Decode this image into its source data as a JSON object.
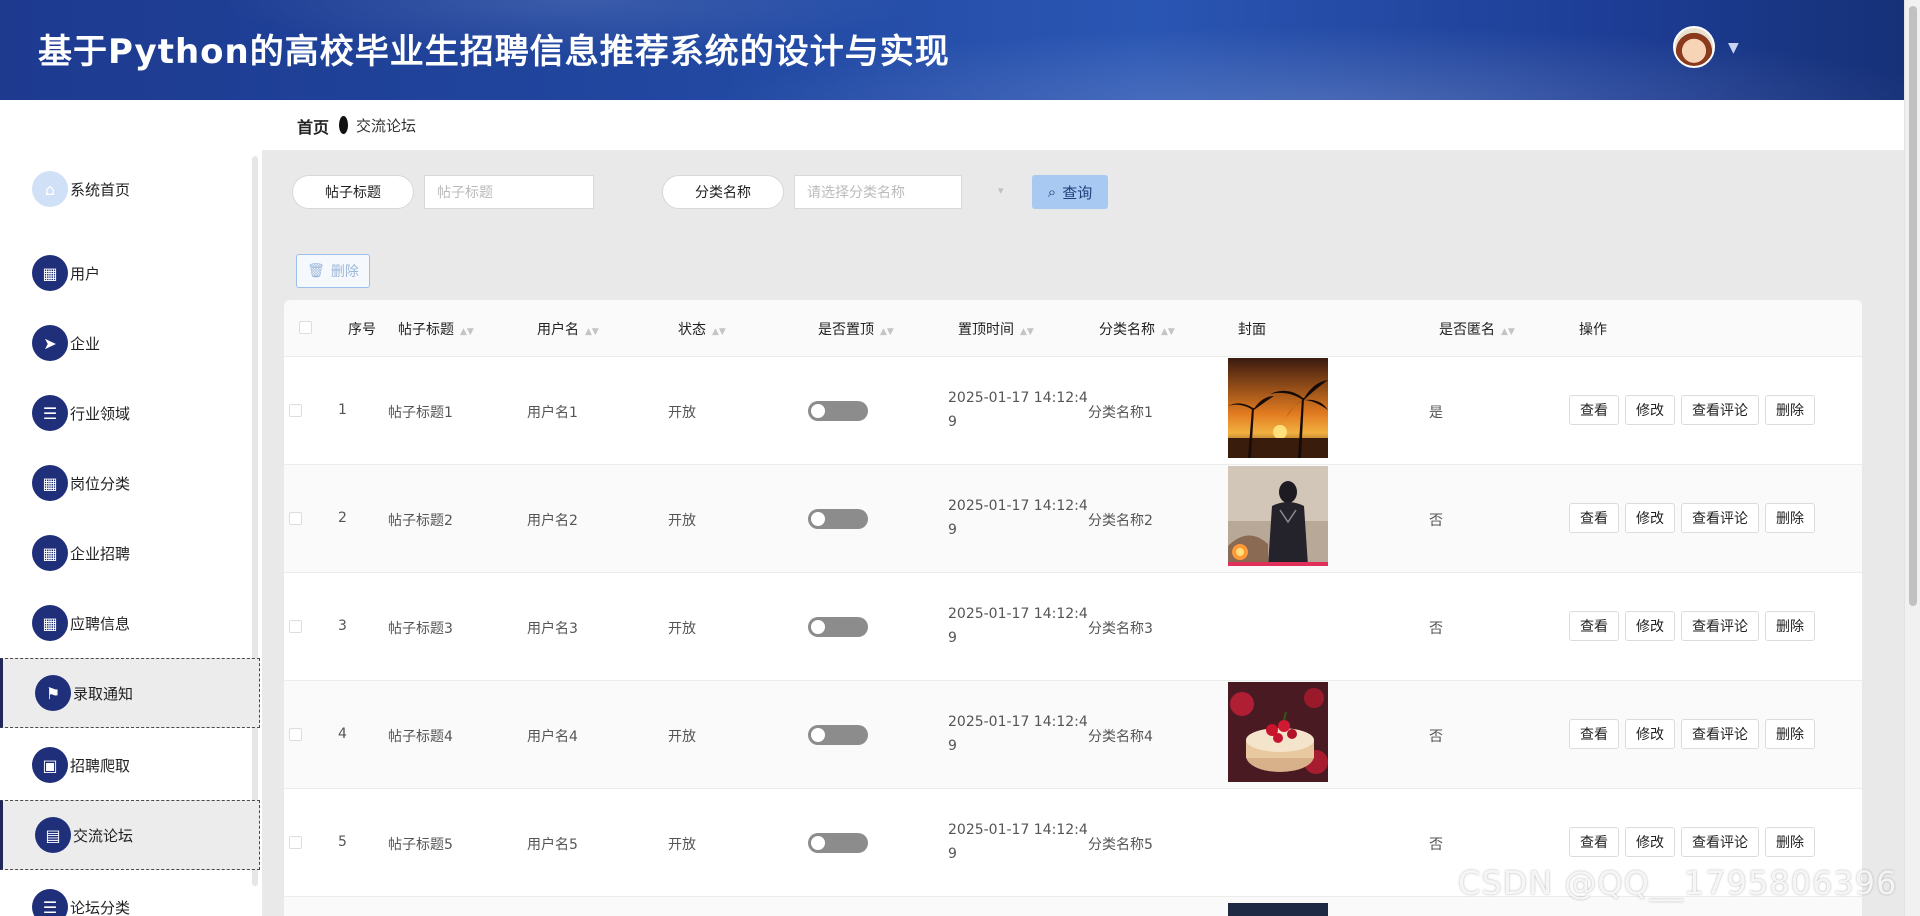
{
  "header": {
    "title": "基于Python的高校毕业生招聘信息推荐系统的设计与实现"
  },
  "breadcrumb": {
    "home": "首页",
    "current": "交流论坛"
  },
  "sidebar": {
    "items": [
      {
        "label": "系统首页",
        "icon": "home-icon"
      },
      {
        "label": "用户",
        "icon": "grid-icon"
      },
      {
        "label": "企业",
        "icon": "send-icon"
      },
      {
        "label": "行业领域",
        "icon": "list-icon"
      },
      {
        "label": "岗位分类",
        "icon": "grid-icon"
      },
      {
        "label": "企业招聘",
        "icon": "grid-icon"
      },
      {
        "label": "应聘信息",
        "icon": "grid-icon"
      },
      {
        "label": "录取通知",
        "icon": "flag-icon"
      },
      {
        "label": "招聘爬取",
        "icon": "briefcase-icon"
      },
      {
        "label": "交流论坛",
        "icon": "clipboard-icon"
      },
      {
        "label": "论坛分类",
        "icon": "list-icon"
      }
    ]
  },
  "search": {
    "title_label": "帖子标题",
    "title_placeholder": "帖子标题",
    "category_label": "分类名称",
    "category_placeholder": "请选择分类名称",
    "query_label": "查询",
    "delete_label": "删除"
  },
  "table": {
    "columns": [
      "序号",
      "帖子标题",
      "用户名",
      "状态",
      "是否置顶",
      "置顶时间",
      "分类名称",
      "封面",
      "是否匿名",
      "操作"
    ],
    "actions": [
      "查看",
      "修改",
      "查看评论",
      "删除"
    ],
    "rows": [
      {
        "index": "1",
        "title": "帖子标题1",
        "user": "用户名1",
        "status": "开放",
        "time_a": "2025-01-17 14:12:4",
        "time_b": "9",
        "category": "分类名称1",
        "cover": "sunset-palm",
        "anonymous": "是"
      },
      {
        "index": "2",
        "title": "帖子标题2",
        "user": "用户名2",
        "status": "开放",
        "time_a": "2025-01-17 14:12:4",
        "time_b": "9",
        "category": "分类名称2",
        "cover": "hero-figure",
        "anonymous": "否"
      },
      {
        "index": "3",
        "title": "帖子标题3",
        "user": "用户名3",
        "status": "开放",
        "time_a": "2025-01-17 14:12:4",
        "time_b": "9",
        "category": "分类名称3",
        "cover": "none",
        "anonymous": "否"
      },
      {
        "index": "4",
        "title": "帖子标题4",
        "user": "用户名4",
        "status": "开放",
        "time_a": "2025-01-17 14:12:4",
        "time_b": "9",
        "category": "分类名称4",
        "cover": "cake-berries",
        "anonymous": "否"
      },
      {
        "index": "5",
        "title": "帖子标题5",
        "user": "用户名5",
        "status": "开放",
        "time_a": "2025-01-17 14:12:4",
        "time_b": "9",
        "category": "分类名称5",
        "cover": "none",
        "anonymous": "否"
      }
    ]
  },
  "watermark": "CSDN @QQ__1795806396",
  "colors": {
    "header": "#2147a0",
    "sidebar_icon": "#1f2f7a",
    "query_button": "#a8c9f2"
  }
}
